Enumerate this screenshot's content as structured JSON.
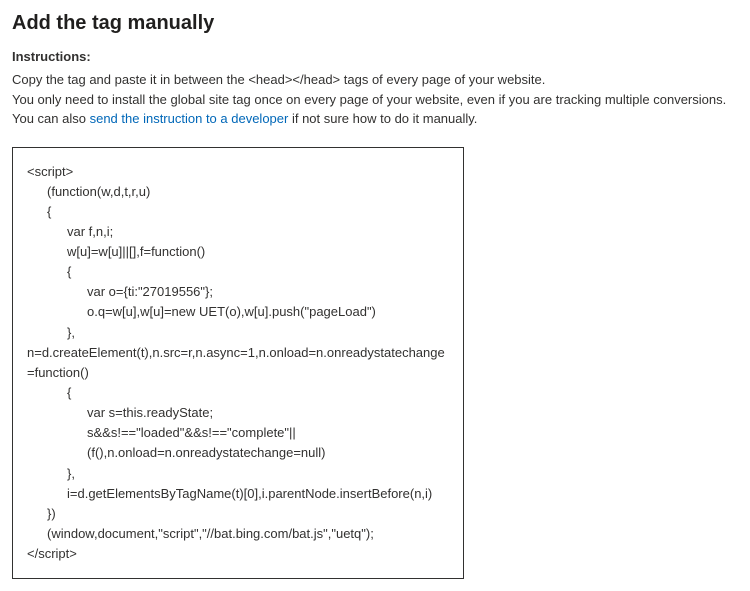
{
  "heading": "Add the tag manually",
  "instructions_label": "Instructions:",
  "instructions": {
    "line1": "Copy the tag and paste it in between the <head></head> tags of every page of your website.",
    "line2": "You only need to install the global site tag once on every page of your website, even if you are tracking multiple conversions.",
    "line3_prefix": "You can also ",
    "line3_link": "send the instruction to a developer",
    "line3_suffix": " if not sure how to do it manually."
  },
  "code": {
    "l01": "<script>",
    "l02": "(function(w,d,t,r,u)",
    "l03": "{",
    "l04": "var f,n,i;",
    "l05": "w[u]=w[u]||[],f=function()",
    "l06": "{",
    "l07": "var o={ti:\"27019556\"};",
    "l08": "o.q=w[u],w[u]=new UET(o),w[u].push(\"pageLoad\")",
    "l09": "},",
    "l10": "n=d.createElement(t),n.src=r,n.async=1,n.onload=n.onreadystatechange=function()",
    "l11": "{",
    "l12": "var s=this.readyState;",
    "l13": "s&&s!==\"loaded\"&&s!==\"complete\"||(f(),n.onload=n.onreadystatechange=null)",
    "l14": "},",
    "l15": "i=d.getElementsByTagName(t)[0],i.parentNode.insertBefore(n,i)",
    "l16": "})",
    "l17": "(window,document,\"script\",\"//bat.bing.com/bat.js\",\"uetq\");",
    "l18": "</script>"
  }
}
